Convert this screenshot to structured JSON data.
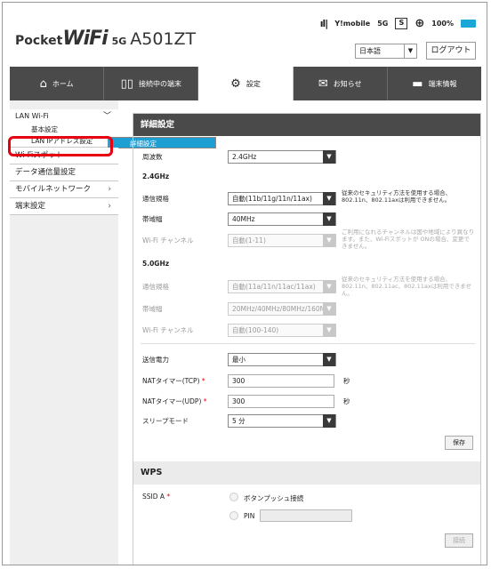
{
  "header": {
    "brand_pocket": "Pocket",
    "brand_wifi": "WiFi",
    "brand_5g": "5G",
    "model": "A501ZT",
    "carrier": "Y!mobile",
    "network": "5G",
    "sim": "S",
    "battery": "100%",
    "language": "日本語",
    "logout_label": "ログアウト"
  },
  "nav": {
    "tabs": [
      {
        "label": "ホーム",
        "icon": "home-icon"
      },
      {
        "label": "接続中の端末",
        "icon": "devices-icon"
      },
      {
        "label": "設定",
        "icon": "gear-icon"
      },
      {
        "label": "お知らせ",
        "icon": "mail-icon"
      },
      {
        "label": "端末情報",
        "icon": "device-info-icon"
      }
    ],
    "active": "設定"
  },
  "sidebar": {
    "lan_wifi": "LAN Wi-Fi",
    "sub_items": [
      "基本設定",
      "詳細設定",
      "LAN IPアドレス設定"
    ],
    "selected": "詳細設定",
    "items": [
      "Wi-Fiスポット",
      "データ通信量設定",
      "モバイルネットワーク",
      "端末設定"
    ]
  },
  "detail": {
    "title": "詳細設定",
    "freq_label": "周波数",
    "freq_value": "2.4GHz",
    "g24": "2.4GHz",
    "g24_std_label": "通信規格",
    "g24_std_value": "自動(11b/11g/11n/11ax)",
    "g24_std_note": "従来のセキュリティ方法を使用する場合、802.11n、802.11axは利用できません。",
    "g24_bw_label": "帯域幅",
    "g24_bw_value": "40MHz",
    "g24_ch_label": "Wi-Fi チャンネル",
    "g24_ch_value": "自動(1-11)",
    "g24_ch_note": "ご利用になれるチャンネルは国や地域により異なります。また、Wi-Fiスポットが ONの場合、変更できません。",
    "g5": "5.0GHz",
    "g5_std_label": "通信規格",
    "g5_std_value": "自動(11a/11n/11ac/11ax)",
    "g5_std_note": "従来のセキュリティ方法を使用する場合、802.11n、802.11ac、802.11axは利用できません。",
    "g5_bw_label": "帯域幅",
    "g5_bw_value": "20MHz/40MHz/80MHz/160M",
    "g5_ch_label": "Wi-Fi チャンネル",
    "g5_ch_value": "自動(100-140)",
    "tx_label": "送信電力",
    "tx_value": "最小",
    "nat_tcp_label": "NATタイマー(TCP)",
    "nat_tcp_value": "300",
    "nat_udp_label": "NATタイマー(UDP)",
    "nat_udp_value": "300",
    "sec_unit": "秒",
    "sleep_label": "スリープモード",
    "sleep_value": "5 分",
    "save_label": "保存"
  },
  "wps": {
    "title": "WPS",
    "ssid_label": "SSID A",
    "push_label": "ボタンプッシュ接続",
    "pin_label": "PIN",
    "connect_label": "接続"
  },
  "colors": {
    "accent": "#1e9fd4",
    "nav_bg": "#4a4a4a",
    "highlight": "#e60012"
  }
}
